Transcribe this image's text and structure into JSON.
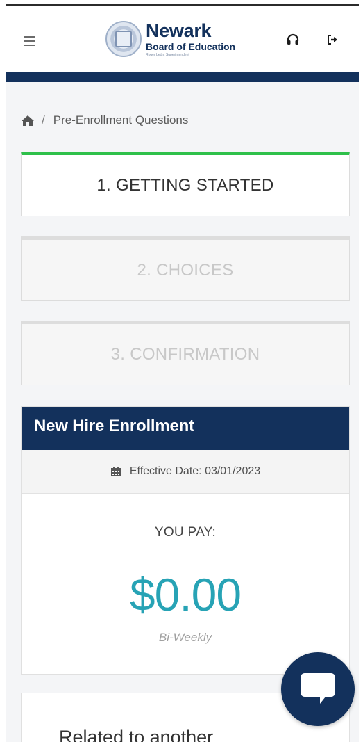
{
  "header": {
    "logo": {
      "name": "Newark",
      "subtitle": "Board of Education",
      "tagline": "Roger León, Superintendent"
    },
    "icons": {
      "menu": "hamburger-menu-icon",
      "support": "headset-icon",
      "logout": "sign-out-icon"
    }
  },
  "breadcrumb": {
    "home_icon": "home-icon",
    "separator": "/",
    "current": "Pre-Enrollment Questions"
  },
  "steps": [
    {
      "label": "1. GETTING STARTED",
      "state": "active"
    },
    {
      "label": "2. CHOICES",
      "state": "inactive"
    },
    {
      "label": "3. CONFIRMATION",
      "state": "inactive"
    }
  ],
  "enrollment": {
    "title": "New Hire Enrollment",
    "effective_date": "Effective Date: 03/01/2023",
    "you_pay_label": "YOU PAY:",
    "amount": "$0.00",
    "frequency": "Bi-Weekly"
  },
  "next_card": {
    "text": "Related to another"
  },
  "chat": {
    "icon": "chat-bubble-icon"
  },
  "colors": {
    "navy": "#13315c",
    "progress_green": "#2ec04a",
    "amount_teal": "#27a3b5"
  }
}
